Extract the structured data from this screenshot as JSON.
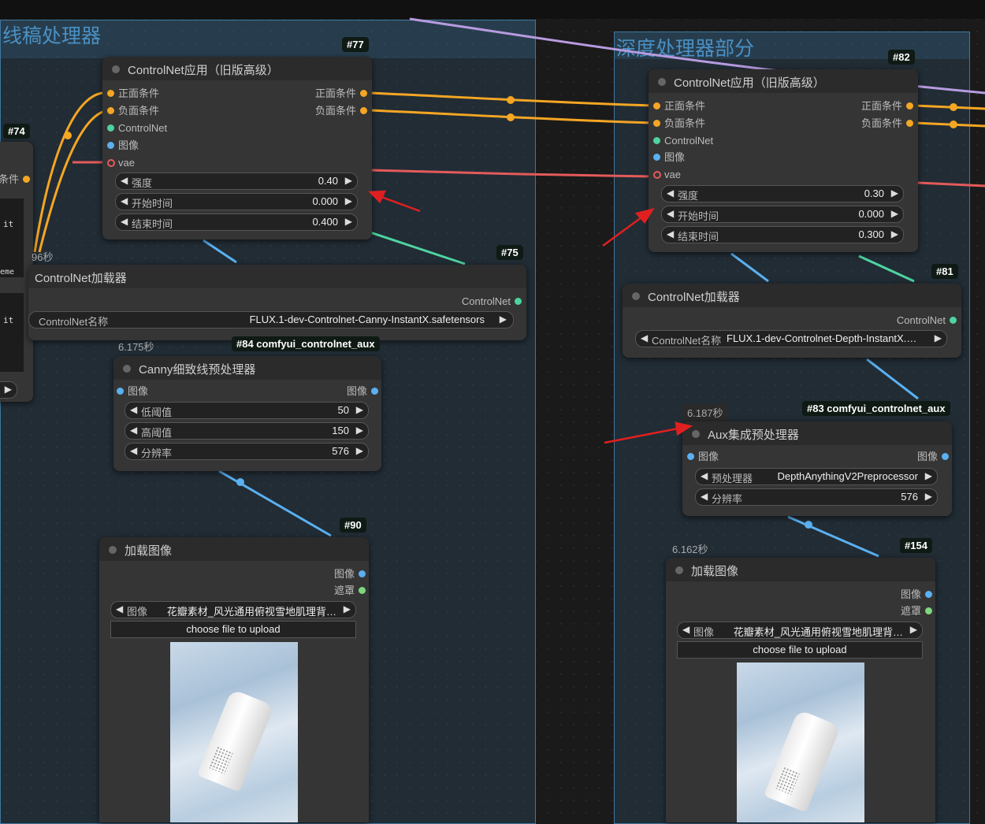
{
  "groups": {
    "lineart": {
      "title": "线稿处理器"
    },
    "depth": {
      "title": "深度处理器部分"
    }
  },
  "node77": {
    "badge": "#77",
    "title": "ControlNet应用（旧版高级）",
    "inputs": [
      "正面条件",
      "负面条件",
      "ControlNet",
      "图像",
      "vae"
    ],
    "outputs": [
      "正面条件",
      "负面条件"
    ],
    "widgets": [
      {
        "name": "强度",
        "value": "0.40"
      },
      {
        "name": "开始时间",
        "value": "0.000"
      },
      {
        "name": "结束时间",
        "value": "0.400"
      }
    ]
  },
  "node74": {
    "badge": "#74",
    "output": "条件",
    "fragments": [
      "it",
      "eme",
      "it"
    ],
    "time": "96秒"
  },
  "node75": {
    "badge": "#75",
    "title": "ControlNet加载器",
    "output": "ControlNet",
    "widget_name": "ControlNet名称",
    "widget_value": "FLUX.1-dev-Controlnet-Canny-InstantX.safetensors"
  },
  "node84": {
    "badge": "#84 comfyui_controlnet_aux",
    "time": "6.175秒",
    "title": "Canny细致线预处理器",
    "input": "图像",
    "output": "图像",
    "widgets": [
      {
        "name": "低阈值",
        "value": "50"
      },
      {
        "name": "高阈值",
        "value": "150"
      },
      {
        "name": "分辨率",
        "value": "576"
      }
    ]
  },
  "node90": {
    "badge": "#90",
    "title": "加载图像",
    "outputs": [
      "图像",
      "遮罩"
    ],
    "widget_name": "图像",
    "widget_value": "花瓣素材_风光通用俯视雪地肌理背…",
    "upload": "choose file to upload"
  },
  "node82": {
    "badge": "#82",
    "title": "ControlNet应用（旧版高级）",
    "inputs": [
      "正面条件",
      "负面条件",
      "ControlNet",
      "图像",
      "vae"
    ],
    "outputs": [
      "正面条件",
      "负面条件"
    ],
    "widgets": [
      {
        "name": "强度",
        "value": "0.30"
      },
      {
        "name": "开始时间",
        "value": "0.000"
      },
      {
        "name": "结束时间",
        "value": "0.300"
      }
    ]
  },
  "node81": {
    "badge": "#81",
    "title": "ControlNet加载器",
    "output": "ControlNet",
    "widget_name": "ControlNet名称",
    "widget_value": "FLUX.1-dev-Controlnet-Depth-InstantX.…"
  },
  "node83": {
    "badge": "#83 comfyui_controlnet_aux",
    "time": "6.187秒",
    "title": "Aux集成预处理器",
    "input": "图像",
    "output": "图像",
    "widgets": [
      {
        "name": "预处理器",
        "value": "DepthAnythingV2Preprocessor"
      },
      {
        "name": "分辨率",
        "value": "576"
      }
    ]
  },
  "node154": {
    "badge": "#154",
    "time": "6.162秒",
    "title": "加载图像",
    "outputs": [
      "图像",
      "遮罩"
    ],
    "widget_name": "图像",
    "widget_value": "花瓣素材_风光通用俯视雪地肌理背…",
    "upload": "choose file to upload"
  },
  "colors": {
    "conditioning": "#f5a623",
    "controlnet": "#4fd3a0",
    "image": "#5ab0f0",
    "vae": "#e45a5a",
    "annotation_arrow": "#e02020",
    "group": "#4a90c4"
  }
}
